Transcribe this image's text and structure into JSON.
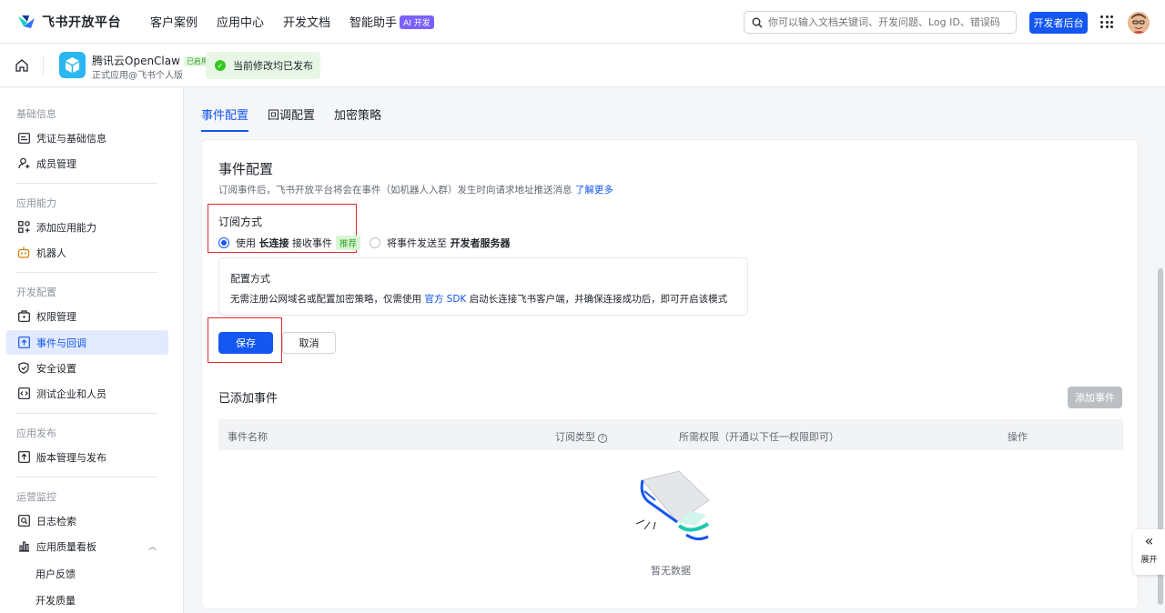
{
  "header": {
    "brand": "飞书开放平台",
    "nav": [
      "客户案例",
      "应用中心",
      "开发文档",
      "智能助手"
    ],
    "ai_badge": "AI 开发",
    "search_placeholder": "你可以输入文档关键词、开发问题、Log ID、错误码",
    "dev_console": "开发者后台"
  },
  "app": {
    "name": "腾讯云OpenClaw",
    "tag": "已启用",
    "sub": "正式应用@飞书个人版",
    "publish_status": "当前修改均已发布"
  },
  "sidebar": {
    "groups": [
      "基础信息",
      "应用能力",
      "开发配置",
      "应用发布",
      "运营监控"
    ],
    "items": [
      "凭证与基础信息",
      "成员管理",
      "添加应用能力",
      "机器人",
      "权限管理",
      "事件与回调",
      "安全设置",
      "测试企业和人员",
      "版本管理与发布",
      "日志检索",
      "应用质量看板"
    ],
    "sub_items": [
      "用户反馈",
      "开发质量"
    ],
    "active": "事件与回调"
  },
  "tabs": [
    "事件配置",
    "回调配置",
    "加密策略"
  ],
  "event_config": {
    "title": "事件配置",
    "desc": "订阅事件后，飞书开放平台将会在事件（如机器人入群）发生时向请求地址推送消息",
    "learn_more": "了解更多",
    "sub_method_label": "订阅方式",
    "option1_prefix": "使用",
    "option1_bold": "长连接",
    "option1_suffix": "接收事件",
    "recommend": "推荐",
    "option2_prefix": "将事件发送至",
    "option2_bold": "开发者服务器",
    "config_title": "配置方式",
    "config_text_1": "无需注册公网域名或配置加密策略，仅需使用",
    "config_link": "官方 SDK",
    "config_text_2": "启动长连接飞书客户端，并确保连接成功后，即可开启该模式",
    "save": "保存",
    "cancel": "取消"
  },
  "added_events": {
    "title": "已添加事件",
    "add_button": "添加事件",
    "columns": [
      "事件名称",
      "订阅类型",
      "所需权限（开通以下任一权限即可）",
      "操作"
    ],
    "empty": "暂无数据"
  },
  "expand_label": "展开",
  "colors": {
    "accent": "#1456f0",
    "success": "#34c724",
    "highlight_border": "#e02b2b"
  }
}
